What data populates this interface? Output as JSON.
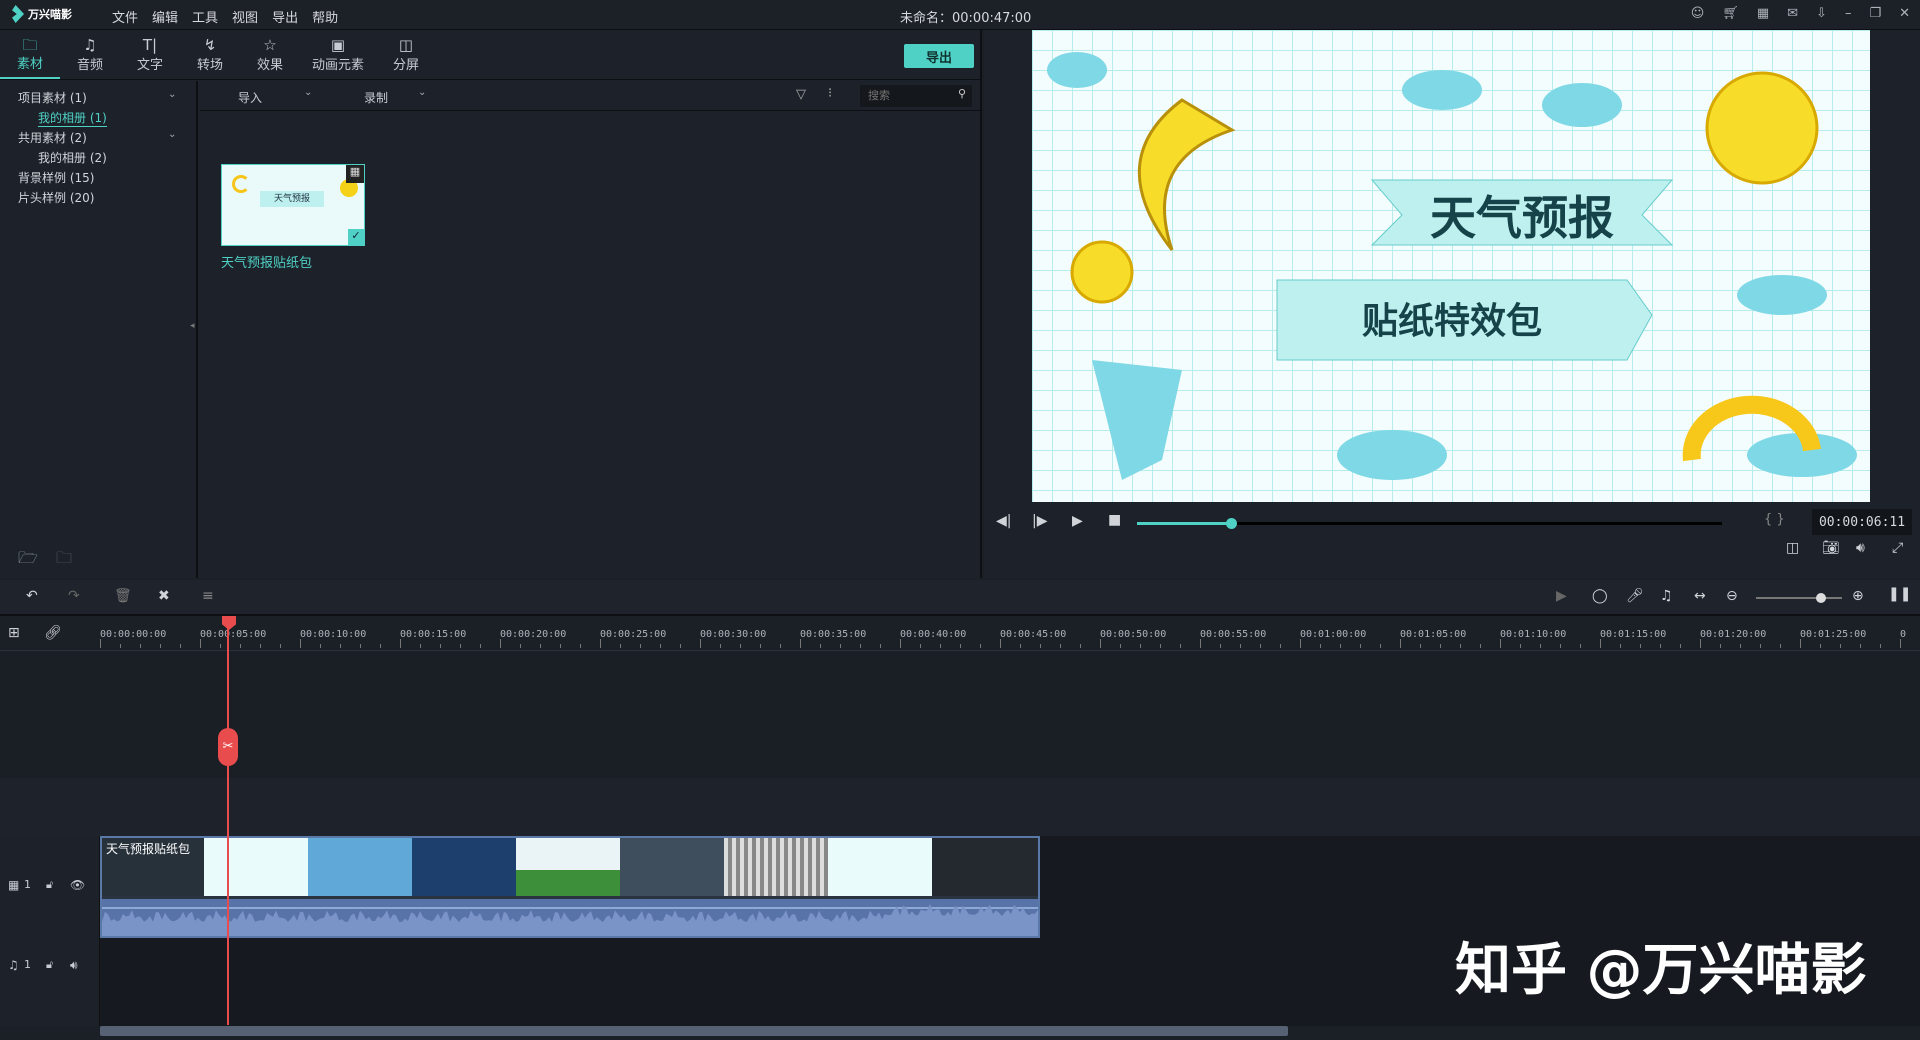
{
  "app": {
    "name": "万兴喵影",
    "title": "未命名：00:00:47:00",
    "menu": [
      "文件",
      "编辑",
      "工具",
      "视图",
      "导出",
      "帮助"
    ]
  },
  "window_icons": [
    "user-icon",
    "cart-icon",
    "save-icon",
    "mail-icon",
    "download-icon",
    "minimize-icon",
    "restore-icon",
    "close-icon"
  ],
  "tabs": [
    {
      "label": "素材",
      "icon": "folder-icon",
      "active": true
    },
    {
      "label": "音频",
      "icon": "music-icon"
    },
    {
      "label": "文字",
      "icon": "text-icon"
    },
    {
      "label": "转场",
      "icon": "transition-icon"
    },
    {
      "label": "效果",
      "icon": "effects-icon"
    },
    {
      "label": "动画元素",
      "icon": "image-icon"
    },
    {
      "label": "分屏",
      "icon": "split-screen-icon"
    }
  ],
  "export_label": "导出",
  "sidebar": [
    {
      "label": "项目素材 (1)"
    },
    {
      "label": "我的相册 (1)"
    },
    {
      "label": "共用素材 (2)"
    },
    {
      "label": "我的相册 (2)"
    },
    {
      "label": "背景样例 (15)"
    },
    {
      "label": "片头样例 (20)"
    }
  ],
  "library": {
    "import_label": "导入",
    "record_label": "录制",
    "search_placeholder": "搜索",
    "items": [
      {
        "name": "天气预报贴纸包",
        "thumb_title": "天气预报"
      }
    ]
  },
  "preview": {
    "title": "天气预报",
    "subtitle": "贴纸特效包",
    "timecode": "00:00:06:11",
    "progress": 0.16,
    "brackets": "{ }"
  },
  "timeline": {
    "ruler": [
      "00:00:00:00",
      "00:00:05:00",
      "00:00:10:00",
      "00:00:15:00",
      "00:00:20:00",
      "00:00:25:00",
      "00:00:30:00",
      "00:00:35:00",
      "00:00:40:00",
      "00:00:45:00",
      "00:00:50:00",
      "00:00:55:00",
      "00:01:00:00",
      "00:01:05:00",
      "00:01:10:00",
      "00:01:15:00",
      "00:01:20:00",
      "00:01:25:00",
      "0"
    ],
    "video_track": {
      "label": "1",
      "clip_name": "天气预报贴纸包"
    },
    "audio_track": {
      "label": "1"
    },
    "zoom_level": 0.75
  },
  "watermark": "知乎 @万兴喵影"
}
